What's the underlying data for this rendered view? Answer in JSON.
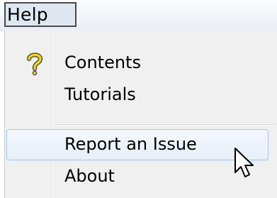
{
  "menubar": {
    "help_label": "Help"
  },
  "menu": {
    "items": [
      {
        "label": "Contents",
        "icon": "help-question-icon",
        "highlighted": false
      },
      {
        "label": "Tutorials",
        "icon": "",
        "highlighted": false
      },
      {
        "label": "Report an Issue",
        "icon": "",
        "highlighted": true
      },
      {
        "label": "About",
        "icon": "",
        "highlighted": false
      }
    ]
  },
  "colors": {
    "highlight_border": "#aac4e6",
    "highlight_fill": "#e6eef9",
    "menu_background": "#f0f0f0",
    "question_icon": "#f2d31b"
  }
}
